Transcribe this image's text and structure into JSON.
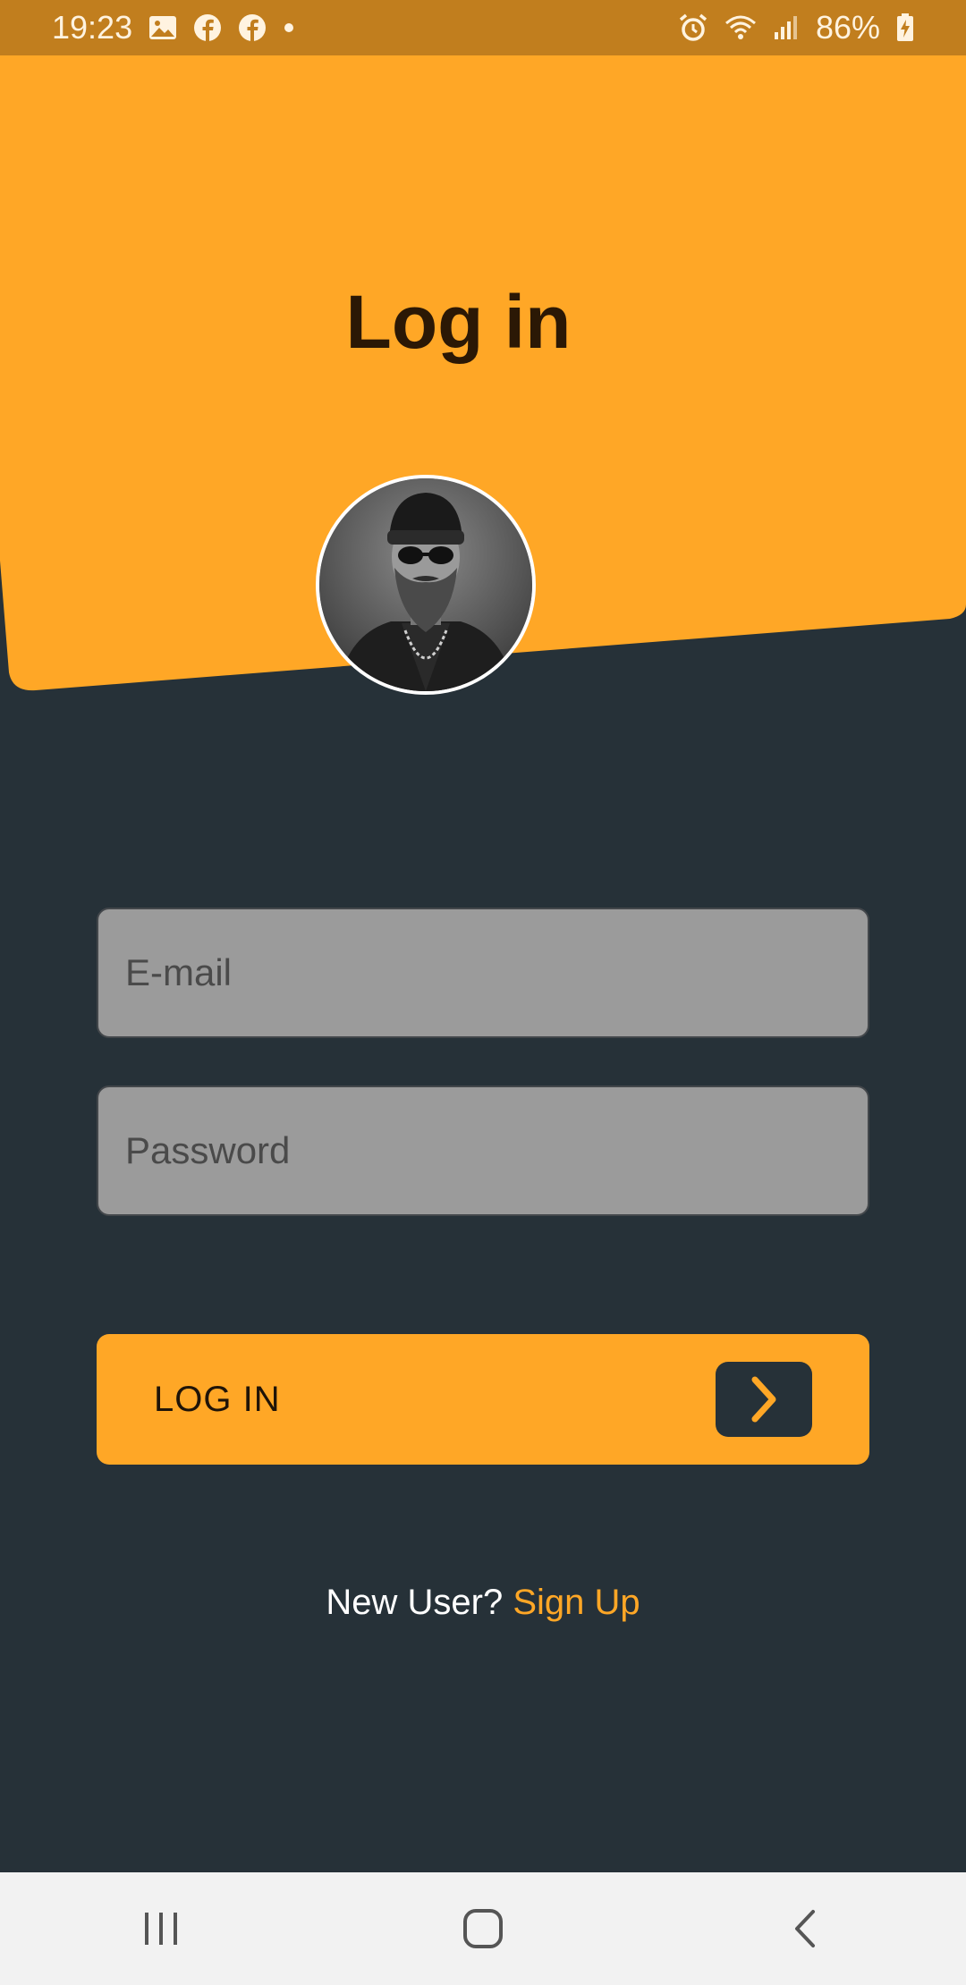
{
  "status_bar": {
    "time": "19:23",
    "battery": "86%",
    "left_icons": [
      "image-icon",
      "facebook-icon",
      "facebook-icon",
      "dot-icon"
    ],
    "right_icons": [
      "alarm-icon",
      "wifi-icon",
      "signal-icon",
      "battery-charging-icon"
    ]
  },
  "header": {
    "title": "Log in",
    "background_color": "#FFA726"
  },
  "form": {
    "email_placeholder": "E-mail",
    "password_placeholder": "Password",
    "login_label": "LOG IN",
    "login_icon": "chevron-right-icon"
  },
  "signup": {
    "prompt": "New User?",
    "link": "Sign Up"
  },
  "nav_bar": {
    "buttons": [
      "recent-apps-icon",
      "home-icon",
      "back-icon"
    ]
  },
  "colors": {
    "accent": "#FFA726",
    "background": "#263138",
    "status_bar": "#C17E1E",
    "field": "#9B9B9B"
  }
}
